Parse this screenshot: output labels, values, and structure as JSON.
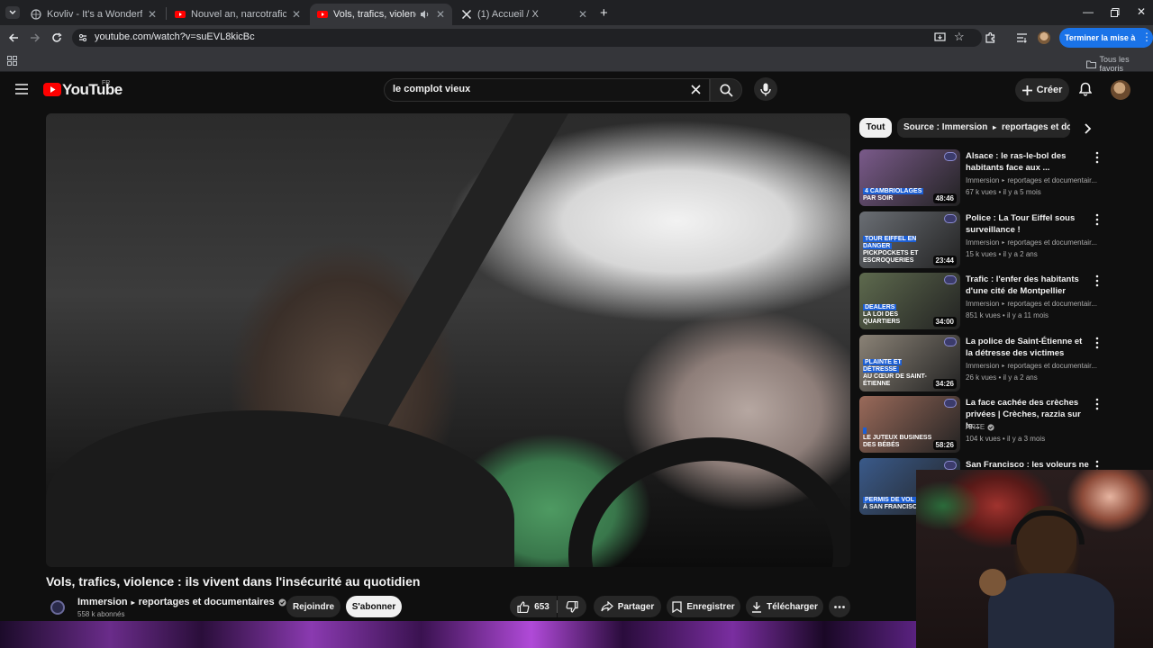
{
  "browser": {
    "tabs": [
      {
        "title": "Kovliv - It's a Wonderful Knife (",
        "active": false
      },
      {
        "title": "Nouvel an, narcotrafic...L'interv",
        "active": false
      },
      {
        "title": "Vols, trafics, violence : ils viv",
        "active": true
      },
      {
        "title": "(1) Accueil / X",
        "active": false
      }
    ],
    "url": "youtube.com/watch?v=suEVL8kicBc",
    "update_button": "Terminer la mise à jour",
    "bookmarks_folder": "Tous les favoris"
  },
  "youtube": {
    "logo_text": "YouTube",
    "country_code": "FR",
    "search_query": "le complot vieux",
    "create_label": "Créer"
  },
  "video": {
    "title": "Vols, trafics, violence : ils vivent dans l'insécurité au quotidien",
    "channel_name": "Immersion",
    "channel_suffix": "reportages et documentaires",
    "subscribers": "558 k abonnés",
    "join_label": "Rejoindre",
    "subscribe_label": "S'abonner",
    "likes": "653",
    "share_label": "Partager",
    "save_label": "Enregistrer",
    "download_label": "Télécharger"
  },
  "chips": {
    "all": "Tout",
    "source": "Source : Immersion",
    "source_suffix": "reportages et documentaires"
  },
  "recommendations": [
    {
      "title": "Alsace : le ras-le-bol des habitants face aux ...",
      "channel": "Immersion",
      "channel_suffix": "reportages et documentair...",
      "views": "67 k vues",
      "age": "il y a 5 mois",
      "duration": "48:46",
      "overlay_hl": "4 CAMBRIOLAGES",
      "overlay_sub": "PAR SOIR",
      "color": "#7a5a8a"
    },
    {
      "title": "Police : La Tour Eiffel sous surveillance !",
      "channel": "Immersion",
      "channel_suffix": "reportages et documentair...",
      "views": "15 k vues",
      "age": "il y a 2 ans",
      "duration": "23:44",
      "overlay_hl": "TOUR EIFFEL EN DANGER",
      "overlay_sub": "PICKPOCKETS ET ESCROQUERIES",
      "color": "#6a6e74"
    },
    {
      "title": "Trafic : l'enfer des habitants d'une cité de Montpellier",
      "channel": "Immersion",
      "channel_suffix": "reportages et documentair...",
      "views": "851 k vues",
      "age": "il y a 11 mois",
      "duration": "34:00",
      "overlay_hl": "DEALERS",
      "overlay_sub": "LA LOI DES QUARTIERS",
      "color": "#5e6a4e"
    },
    {
      "title": "La police de Saint-Étienne et la détresse des victimes",
      "channel": "Immersion",
      "channel_suffix": "reportages et documentair...",
      "views": "26 k vues",
      "age": "il y a 2 ans",
      "duration": "34:26",
      "overlay_hl": "PLAINTE ET DÉTRESSE",
      "overlay_sub": "AU CŒUR DE SAINT-ÉTIENNE",
      "color": "#8a8276"
    },
    {
      "title": "La face cachée des crèches privées | Crèches, razzia sur le...",
      "channel": "ARTE",
      "channel_suffix": "",
      "views": "104 k vues",
      "age": "il y a 3 mois",
      "duration": "58:26",
      "overlay_hl": "",
      "overlay_sub": "LE JUTEUX BUSINESS DES BÉBÉS",
      "color": "#9a6a5a"
    },
    {
      "title": "San Francisco : les voleurs ne",
      "channel": "",
      "channel_suffix": "",
      "views": "",
      "age": "",
      "duration": "",
      "overlay_hl": "PERMIS DE VOL",
      "overlay_sub": "À SAN FRANCISCO",
      "color": "#3a5a8a"
    }
  ]
}
